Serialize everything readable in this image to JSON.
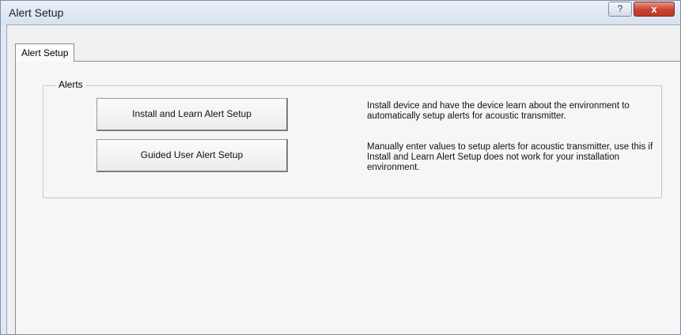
{
  "window": {
    "title": "Alert Setup",
    "help_label": "?",
    "close_label": "x"
  },
  "tabs": [
    {
      "label": "Alert Setup",
      "selected": true
    }
  ],
  "alerts_group": {
    "label": "Alerts",
    "buttons": [
      {
        "label": "Install and Learn Alert Setup",
        "description": "Install device and have the device learn about the environment to automatically setup alerts for acoustic transmitter."
      },
      {
        "label": "Guided User Alert Setup",
        "description": "Manually enter values to setup alerts for acoustic transmitter, use this if Install and Learn Alert Setup does not work for your installation environment."
      }
    ]
  }
}
